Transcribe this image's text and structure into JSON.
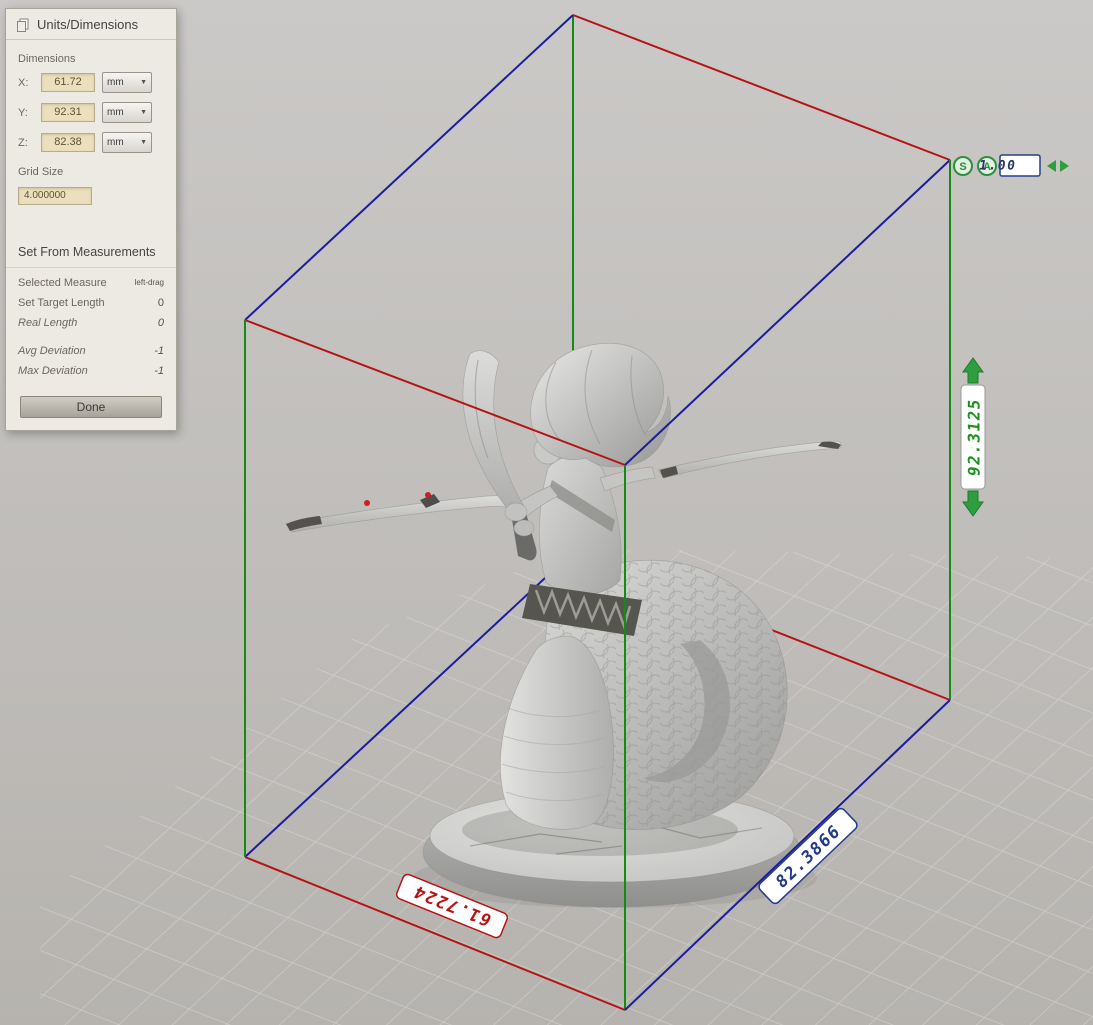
{
  "panel": {
    "title": "Units/Dimensions",
    "dimensions_label": "Dimensions",
    "dims": [
      {
        "axis": "X:",
        "value": "61.72",
        "unit": "mm"
      },
      {
        "axis": "Y:",
        "value": "92.31",
        "unit": "mm"
      },
      {
        "axis": "Z:",
        "value": "82.38",
        "unit": "mm"
      }
    ],
    "grid_size_label": "Grid Size",
    "grid_size_value": "4.000000",
    "measure_header": "Set From Measurements",
    "measures": [
      {
        "label": "Selected Measure",
        "value": "left-drag"
      },
      {
        "label": "Set Target Length",
        "value": "0"
      },
      {
        "label": "Real Length",
        "value": "0"
      },
      {
        "label": "Avg Deviation",
        "value": "-1"
      },
      {
        "label": "Max Deviation",
        "value": "-1"
      }
    ],
    "done_label": "Done"
  },
  "viewport": {
    "measure_x": "61.7224",
    "measure_y": "92.3125",
    "measure_z": "82.3866",
    "scale_value": "1.00",
    "smooth_badge": "S",
    "axis_badge": "A"
  },
  "colors": {
    "axis_x_red": "#b51414",
    "axis_y_green": "#128c14",
    "axis_z_blue": "#1c1c9e",
    "measure_green": "#1f8f1f",
    "measure_blue": "#223a8c",
    "measure_red": "#b51414"
  }
}
